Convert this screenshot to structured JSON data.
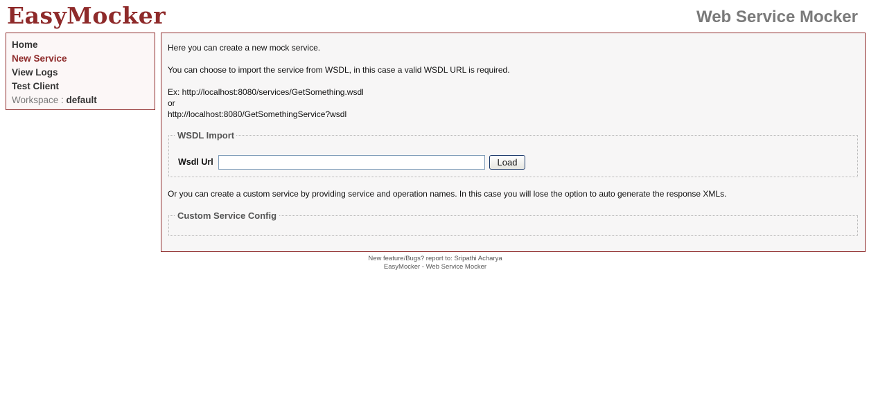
{
  "header": {
    "logo": "EasyMocker",
    "tagline": "Web Service Mocker"
  },
  "sidebar": {
    "items": [
      {
        "label": "Home"
      },
      {
        "label": "New Service"
      },
      {
        "label": "View Logs"
      },
      {
        "label": "Test Client"
      }
    ],
    "active_item": "New Service",
    "workspace_label": "Workspace :",
    "workspace_value": "default"
  },
  "main": {
    "intro": "Here you can create a new mock service.",
    "wsdl_info": "You can choose to import the service from WSDL, in this case a valid WSDL URL is required.",
    "example_line1": "Ex: http://localhost:8080/services/GetSomething.wsdl",
    "example_or": "or",
    "example_line2": "http://localhost:8080/GetSomethingService?wsdl",
    "wsdl_import": {
      "legend": "WSDL Import",
      "label": "Wsdl Url",
      "input_value": "",
      "button": "Load"
    },
    "custom_info": "Or you can create a custom service by providing service and operation names. In this case you will lose the option to auto generate the response XMLs.",
    "custom_config": {
      "legend": "Custom Service Config"
    }
  },
  "footer": {
    "line1": "New feature/Bugs? report to: Sripathi Acharya",
    "line2": "EasyMocker - Web Service Mocker"
  }
}
